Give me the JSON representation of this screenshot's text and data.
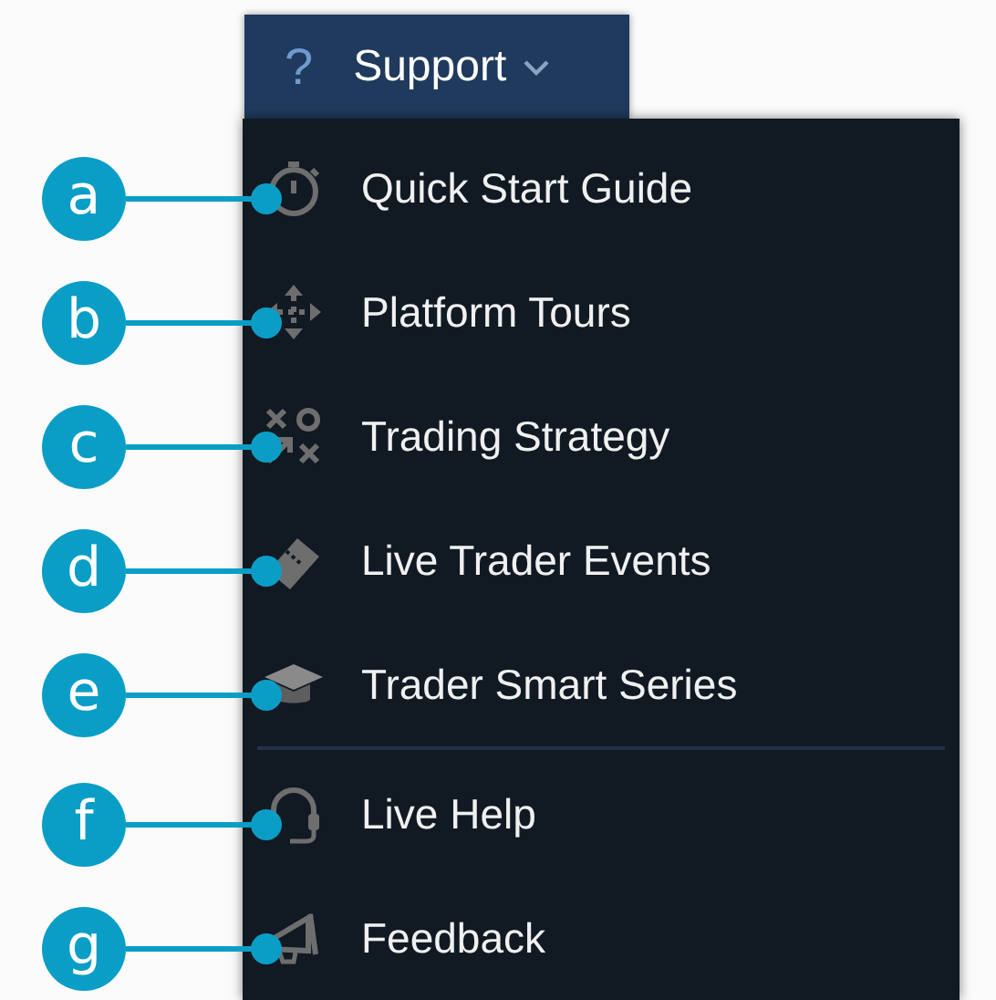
{
  "menu_button": {
    "icon_text": "?",
    "label": "Support",
    "expanded": true
  },
  "menu_groups": [
    {
      "items": [
        {
          "label": "Quick Start Guide",
          "callout": "a"
        },
        {
          "label": "Platform Tours",
          "callout": "b"
        },
        {
          "label": "Trading Strategy",
          "callout": "c"
        },
        {
          "label": "Live Trader Events",
          "callout": "d"
        },
        {
          "label": "Trader Smart Series",
          "callout": "e"
        }
      ]
    },
    {
      "items": [
        {
          "label": "Live Help",
          "callout": "f"
        },
        {
          "label": "Feedback",
          "callout": "g"
        }
      ]
    }
  ]
}
